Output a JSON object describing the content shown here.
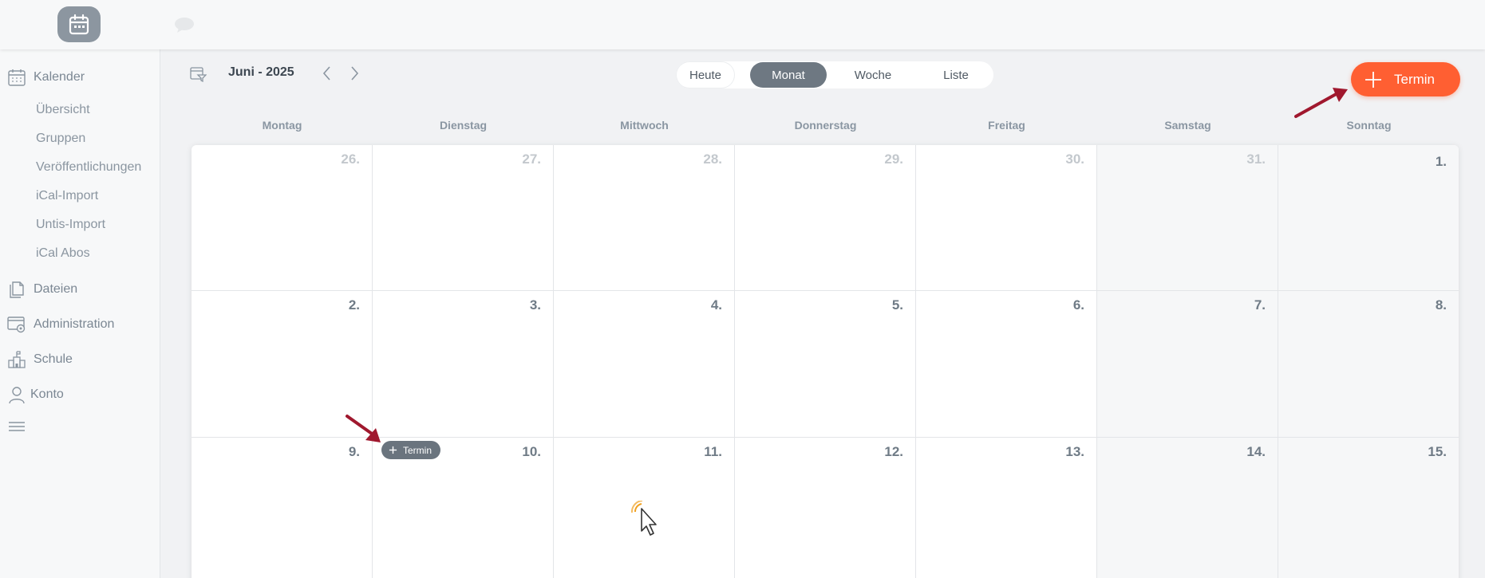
{
  "topbar": {
    "logo_icon": "calendar-icon",
    "chat_icon": "speech-bubble-icon"
  },
  "sidebar": {
    "kalender": {
      "label": "Kalender",
      "icon": "calendar-icon"
    },
    "sub_items": [
      {
        "label": "Übersicht"
      },
      {
        "label": "Gruppen"
      },
      {
        "label": "Veröffentlichungen"
      },
      {
        "label": "iCal-Import"
      },
      {
        "label": "Untis-Import"
      },
      {
        "label": "iCal Abos"
      }
    ],
    "dateien": {
      "label": "Dateien",
      "icon": "documents-icon"
    },
    "administration": {
      "label": "Administration",
      "icon": "admin-settings-icon"
    },
    "schule": {
      "label": "Schule",
      "icon": "school-icon"
    },
    "konto": {
      "label": "Konto",
      "icon": "user-icon"
    },
    "menu_icon": "hamburger-icon"
  },
  "calendar": {
    "month_title": "Juni - 2025",
    "views": {
      "today": "Heute",
      "month": "Monat",
      "week": "Woche",
      "list": "Liste"
    },
    "active_view": "Monat",
    "add_button_label": "Termin",
    "inline_add_label": "Termin",
    "weekdays": [
      "Montag",
      "Dienstag",
      "Mittwoch",
      "Donnerstag",
      "Freitag",
      "Samstag",
      "Sonntag"
    ],
    "weeks": [
      [
        {
          "d": "26.",
          "muted": true
        },
        {
          "d": "27.",
          "muted": true
        },
        {
          "d": "28.",
          "muted": true
        },
        {
          "d": "29.",
          "muted": true
        },
        {
          "d": "30.",
          "muted": true
        },
        {
          "d": "31.",
          "muted": true
        },
        {
          "d": "1.",
          "muted": false
        }
      ],
      [
        {
          "d": "2.",
          "muted": false
        },
        {
          "d": "3.",
          "muted": false
        },
        {
          "d": "4.",
          "muted": false
        },
        {
          "d": "5.",
          "muted": false
        },
        {
          "d": "6.",
          "muted": false
        },
        {
          "d": "7.",
          "muted": false
        },
        {
          "d": "8.",
          "muted": false
        }
      ],
      [
        {
          "d": "9.",
          "muted": false
        },
        {
          "d": "10.",
          "muted": false
        },
        {
          "d": "11.",
          "muted": false
        },
        {
          "d": "12.",
          "muted": false
        },
        {
          "d": "13.",
          "muted": false
        },
        {
          "d": "14.",
          "muted": false
        },
        {
          "d": "15.",
          "muted": false
        }
      ]
    ]
  },
  "colors": {
    "accent": "#ff5f32",
    "active_view": "#6e7882",
    "annotation_arrow": "#a0182e",
    "cursor_highlight": "#f0a020"
  }
}
